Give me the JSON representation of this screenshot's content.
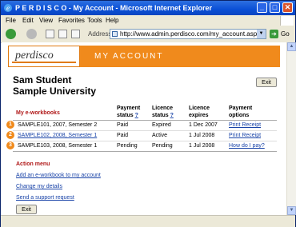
{
  "window": {
    "title": "P E R D I S C O - My Account - Microsoft Internet Explorer",
    "minimize": "_",
    "maximize": "□",
    "close": "✕"
  },
  "menu": [
    "File",
    "Edit",
    "View",
    "Favorites",
    "Tools",
    "Help"
  ],
  "toolbar": {
    "address_label": "Address",
    "url": "http://www.admin.perdisco.com/my_account.asp",
    "go_label": "Go"
  },
  "page": {
    "logo": "perdisco",
    "banner": "MY ACCOUNT",
    "student_name": "Sam Student",
    "university": "Sample University",
    "exit_label": "Exit",
    "table": {
      "col_workbooks": "My e-workbooks",
      "col_payment": "Payment",
      "col_payment2": "status",
      "col_licence": "Licence",
      "col_licence2": "status",
      "col_expires": "Licence",
      "col_expires2": "expires",
      "col_options": "Payment",
      "col_options2": "options",
      "help": "?",
      "rows": [
        {
          "num": "1",
          "workbook": "SAMPLE101, 2007, Semester 2",
          "payment": "Paid",
          "licence": "Expired",
          "expires": "1 Dec 2007",
          "option": "Print Receipt"
        },
        {
          "num": "2",
          "workbook": "SAMPLE102, 2008, Semester 1",
          "payment": "Paid",
          "licence": "Active",
          "expires": "1 Jul 2008",
          "option": "Print Receipt"
        },
        {
          "num": "3",
          "workbook": "SAMPLE103, 2008, Semester 1",
          "payment": "Pending",
          "licence": "Pending",
          "expires": "1 Jul 2008",
          "option": "How do I pay?"
        }
      ]
    },
    "action_menu": {
      "title": "Action menu",
      "items": [
        "Add an e-workbook to my account",
        "Change my details",
        "Send a support request"
      ],
      "exit_label": "Exit"
    }
  },
  "colors": {
    "accent": "#f08a1c",
    "header_red": "#b01818",
    "link": "#1a44a8"
  }
}
